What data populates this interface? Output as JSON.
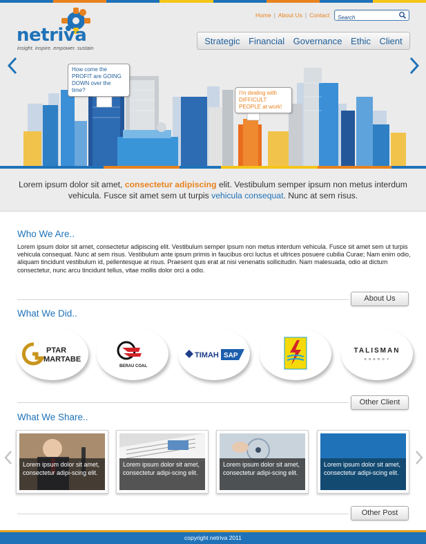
{
  "brand": {
    "name": "netriva",
    "tagline": "insight. inspire. empower. sustain",
    "colors": {
      "blue": "#1f72b8",
      "orange": "#e8821e",
      "yellow": "#f5c518",
      "grey": "#ebebeb"
    }
  },
  "top_links": [
    "Home",
    "About Us",
    "Contact"
  ],
  "search": {
    "placeholder": "Search",
    "icon": "search-icon"
  },
  "nav": [
    "Strategic",
    "Financial",
    "Governance",
    "Ethic",
    "Client"
  ],
  "hero": {
    "bubble_left": "How come the PROFIT are GOING DOWN over the time?",
    "bubble_right": "I'm dealing with DIFFICULT PEOPLE at work!",
    "prev_icon": "chevron-left-icon",
    "next_icon": "chevron-right-icon"
  },
  "tagline": {
    "part1": "Lorem ipsum dolor sit amet, ",
    "highlight1": "consectetur adipiscing",
    "part2": " elit. Vestibulum semper ipsum non metus interdum vehicula. Fusce sit amet sem ut turpis ",
    "highlight2": "vehicula consequat",
    "part3": ". Nunc at sem risus."
  },
  "who": {
    "title": "Who We Are..",
    "text": "Lorem ipsum dolor sit amet, consectetur adipiscing elit. Vestibulum semper ipsum non metus interdum vehicula. Fusce sit amet sem ut turpis vehicula consequat. Nunc at sem risus. Vestibulum ante ipsum primis in faucibus orci luctus et ultrices posuere cubilia Curae; Nam enim odio, aliquam tincidunt vestibulum id, pellentesque at risus. Praesent quis erat at nisi venenatis sollicitudin. Nam malesuada, odio at dictum consectetur, nunc arcu tincidunt tellus, vitae mollis dolor orci a odio.",
    "button": "About Us"
  },
  "did": {
    "title": "What We Did..",
    "clients": [
      {
        "line1": "PTAR",
        "line2": "MARTABE"
      },
      {
        "line1": "BERAU COAL"
      },
      {
        "line1": "TIMAH",
        "line2": "SAP"
      },
      {
        "line1": ""
      },
      {
        "line1": "TALISMAN",
        "line2": "E N E R G Y"
      }
    ],
    "button": "Other Client"
  },
  "share": {
    "title": "What We Share..",
    "posts": [
      {
        "caption": "Lorem ipsum dolor sit amet, consectetur adipi-scing elit."
      },
      {
        "caption": "Lorem ipsum dolor sit amet, consectetur adipi-scing elit."
      },
      {
        "caption": "Lorem ipsum dolor sit amet, consectetur adipi-scing elit."
      },
      {
        "caption": "Lorem ipsum dolor sit amet, consectetur adipi-scing elit."
      }
    ],
    "button": "Other Post"
  },
  "footer": {
    "copyright": "copyright netriva 2011"
  }
}
